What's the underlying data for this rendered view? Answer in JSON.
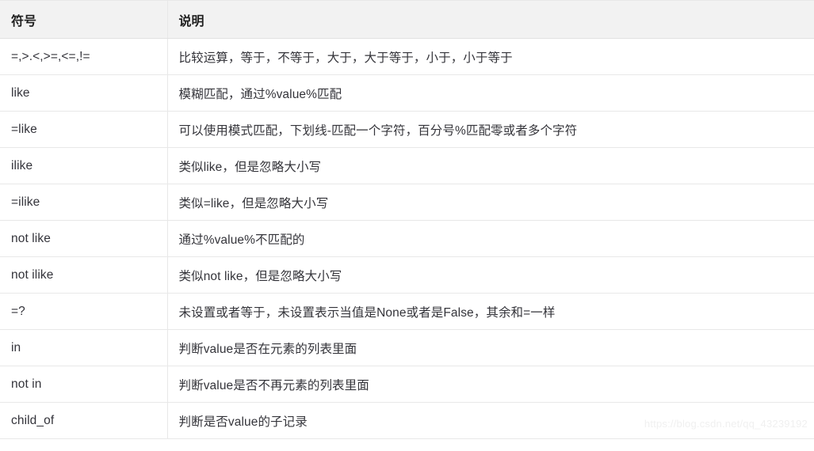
{
  "table": {
    "columns": [
      {
        "key": "symbol",
        "label": "符号"
      },
      {
        "key": "description",
        "label": "说明"
      }
    ],
    "rows": [
      {
        "symbol": "=,>.<,>=,<=,!=",
        "description": "比较运算，等于，不等于，大于，大于等于，小于，小于等于"
      },
      {
        "symbol": "like",
        "description": "模糊匹配，通过%value%匹配"
      },
      {
        "symbol": "=like",
        "description": "可以使用模式匹配，下划线-匹配一个字符，百分号%匹配零或者多个字符"
      },
      {
        "symbol": "ilike",
        "description": "类似like，但是忽略大小写"
      },
      {
        "symbol": "=ilike",
        "description": "类似=like，但是忽略大小写"
      },
      {
        "symbol": "not like",
        "description": "通过%value%不匹配的"
      },
      {
        "symbol": "not ilike",
        "description": "类似not like，但是忽略大小写"
      },
      {
        "symbol": "=?",
        "description": "未设置或者等于，未设置表示当值是None或者是False，其余和=一样"
      },
      {
        "symbol": "in",
        "description": "判断value是否在元素的列表里面"
      },
      {
        "symbol": "not in",
        "description": "判断value是否不再元素的列表里面"
      },
      {
        "symbol": "child_of",
        "description": "判断是否value的子记录"
      }
    ]
  },
  "watermark": {
    "text": "https://blog.csdn.net/qq_43239192"
  },
  "colors": {
    "header_background": "#f2f2f2",
    "border": "#e8e8e8",
    "text": "#34343a",
    "watermark": "#f0f0f0"
  }
}
